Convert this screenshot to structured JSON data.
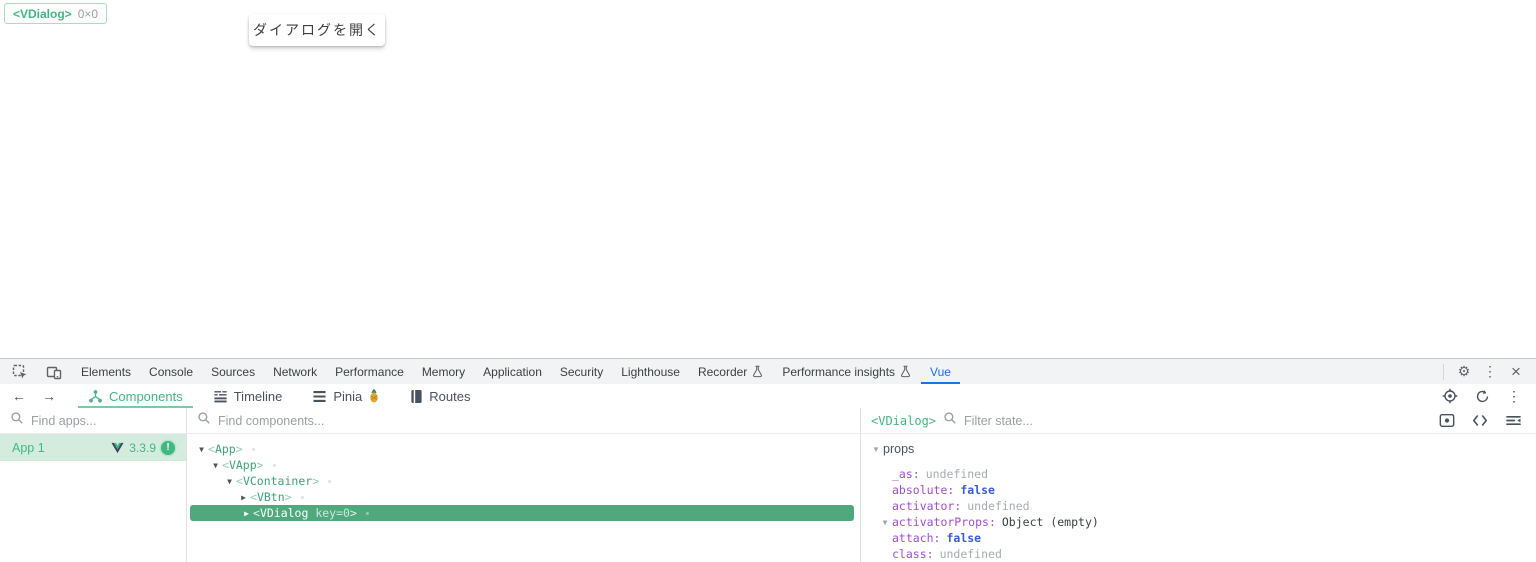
{
  "colors": {
    "vue_green": "#41b883",
    "chrome_blue": "#1a73e8",
    "selected_row_green": "#4fa97d",
    "prop_key_purple": "#a04fc7",
    "bool_blue": "#3a5bdb",
    "app_row_bg": "#d4ecde"
  },
  "page": {
    "overlay_badge": {
      "tag": "<VDialog>",
      "size": "0×0"
    },
    "open_dialog_button": "ダイアログを開く"
  },
  "devtools": {
    "tabs": [
      {
        "label": "Elements"
      },
      {
        "label": "Console"
      },
      {
        "label": "Sources"
      },
      {
        "label": "Network"
      },
      {
        "label": "Performance"
      },
      {
        "label": "Memory"
      },
      {
        "label": "Application"
      },
      {
        "label": "Security"
      },
      {
        "label": "Lighthouse"
      },
      {
        "label": "Recorder",
        "flask": true
      },
      {
        "label": "Performance insights",
        "flask": true
      },
      {
        "label": "Vue",
        "active": true
      }
    ],
    "tabbar_glyphs": {
      "settings": "⚙",
      "menu_dots": "⋮",
      "close": "×"
    },
    "vue_toolbar": {
      "back": "←",
      "forward": "→",
      "tabs": [
        {
          "label": "Components",
          "icon": "components",
          "active": true
        },
        {
          "label": "Timeline",
          "icon": "timeline"
        },
        {
          "label": "Pinia",
          "icon": "list",
          "badge_icon": "pineapple"
        },
        {
          "label": "Routes",
          "icon": "book"
        }
      ]
    },
    "apps_panel": {
      "search_placeholder": "Find apps...",
      "items": [
        {
          "name": "App 1",
          "version": "3.3.9",
          "plugin_badge": "!",
          "selected": true
        }
      ]
    },
    "components_panel": {
      "search_placeholder": "Find components...",
      "tree": [
        {
          "tag": "App",
          "depth": 0,
          "state": "expanded"
        },
        {
          "tag": "VApp",
          "depth": 1,
          "state": "expanded"
        },
        {
          "tag": "VContainer",
          "depth": 2,
          "state": "expanded"
        },
        {
          "tag": "VBtn",
          "depth": 3,
          "state": "collapsed"
        },
        {
          "tag": "VDialog",
          "attrs": "key=0",
          "depth": 3,
          "state": "collapsed",
          "selected": true
        }
      ]
    },
    "state_panel": {
      "selected_tag": "<VDialog>",
      "filter_placeholder": "Filter state...",
      "sections": [
        {
          "name": "props",
          "expanded": true,
          "items": [
            {
              "key": "_as",
              "value": "undefined",
              "kind": "muted"
            },
            {
              "key": "absolute",
              "value": "false",
              "kind": "bool"
            },
            {
              "key": "activator",
              "value": "undefined",
              "kind": "muted"
            },
            {
              "key": "activatorProps",
              "value": "Object (empty)",
              "kind": "object",
              "expandable": true
            },
            {
              "key": "attach",
              "value": "false",
              "kind": "bool"
            },
            {
              "key": "class",
              "value": "undefined",
              "kind": "muted"
            }
          ]
        }
      ]
    }
  }
}
